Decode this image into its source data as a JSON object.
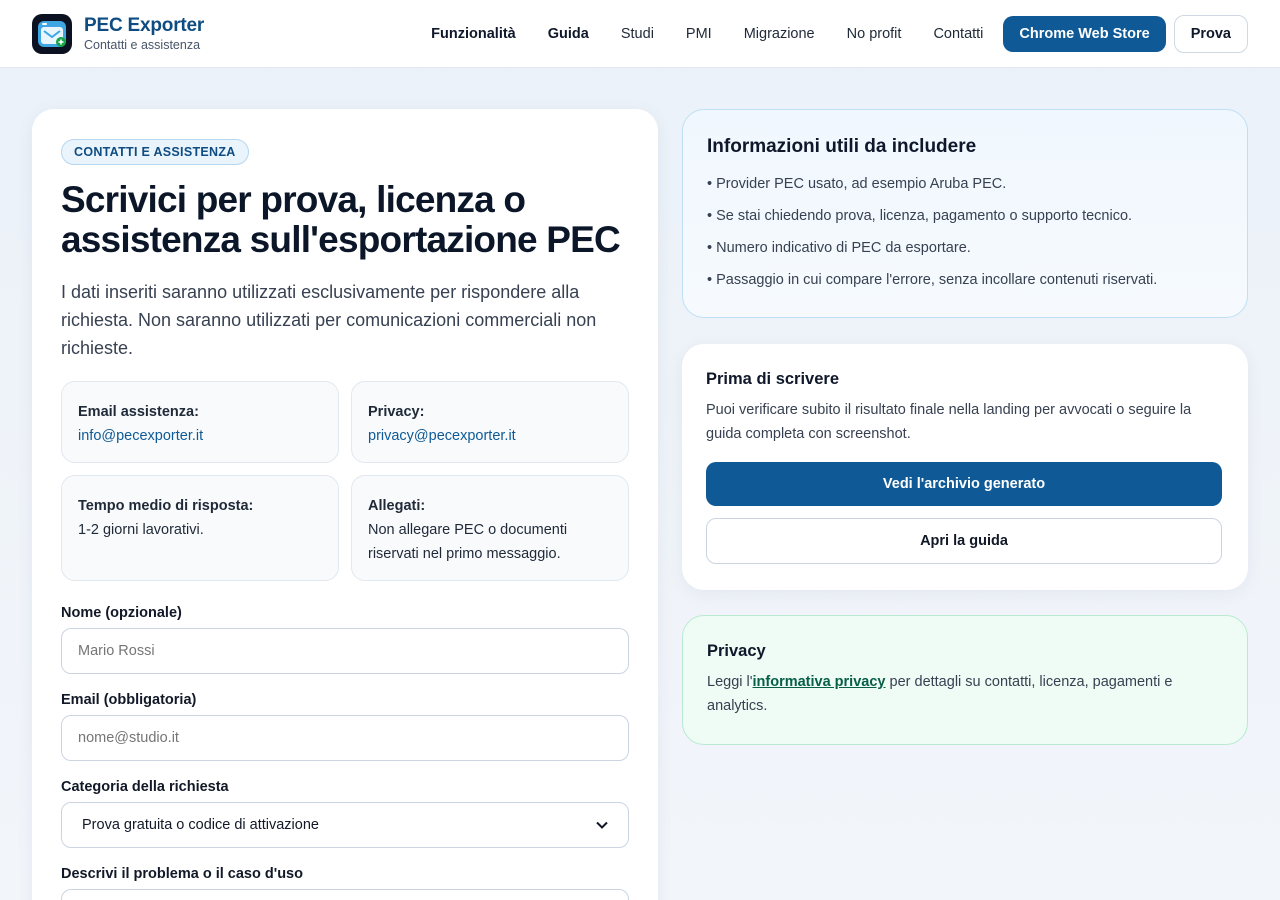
{
  "header": {
    "brand_name": "PEC Exporter",
    "brand_sub": "Contatti e assistenza",
    "nav": [
      "Funzionalità",
      "Guida",
      "Studi",
      "PMI",
      "Migrazione",
      "No profit",
      "Contatti"
    ],
    "store_button": "Chrome Web Store",
    "trial_button": "Prova"
  },
  "main": {
    "pill": "CONTATTI E ASSISTENZA",
    "title": "Scrivici per prova, licenza o assistenza sull'esportazione PEC",
    "lead": "I dati inseriti saranno utilizzati esclusivamente per rispondere alla richiesta. Non saranno utilizzati per comunicazioni commerciali non richieste.",
    "tiles": [
      {
        "label": "Email assistenza:",
        "value": "info@pecexporter.it"
      },
      {
        "label": "Privacy:",
        "value": "privacy@pecexporter.it"
      },
      {
        "label": "Tempo medio di risposta:",
        "value": "1-2 giorni lavorativi."
      },
      {
        "label": "Allegati:",
        "value": "Non allegare PEC o documenti riservati nel primo messaggio."
      }
    ],
    "form": {
      "name_label": "Nome (opzionale)",
      "name_placeholder": "Mario Rossi",
      "email_label": "Email (obbligatoria)",
      "email_placeholder": "nome@studio.it",
      "category_label": "Categoria della richiesta",
      "category_value": "Prova gratuita o codice di attivazione",
      "description_label": "Descrivi il problema o il caso d'uso"
    }
  },
  "info_card": {
    "title": "Informazioni utili da includere",
    "items": [
      "• Provider PEC usato, ad esempio Aruba PEC.",
      "• Se stai chiedendo prova, licenza, pagamento o supporto tecnico.",
      "• Numero indicativo di PEC da esportare.",
      "• Passaggio in cui compare l'errore, senza incollare contenuti riservati."
    ]
  },
  "before_card": {
    "title": "Prima di scrivere",
    "text": "Puoi verificare subito il risultato finale nella landing per avvocati o seguire la guida completa con screenshot.",
    "primary_button": "Vedi l'archivio generato",
    "secondary_button": "Apri la guida"
  },
  "privacy_card": {
    "title": "Privacy",
    "text_before": "Leggi l'",
    "link": "informativa privacy",
    "text_after": " per dettagli su contatti, licenza, pagamenti e analytics."
  },
  "colors": {
    "accent": "#0f5a96",
    "brand_text": "#0f4c81",
    "privacy_bg": "#effbf5"
  },
  "icons": {
    "logo": "email-export-icon",
    "select": "chevron-down-icon"
  }
}
